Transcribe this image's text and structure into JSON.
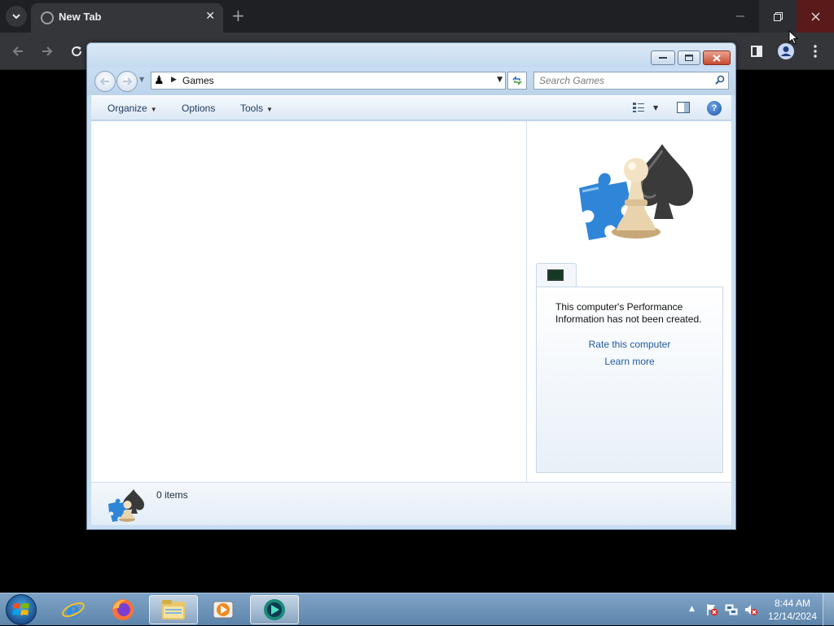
{
  "chrome": {
    "tab_title": "New Tab",
    "icons": {
      "tab_search": "chevron-down-icon",
      "favicon": "globe-icon",
      "tab_close": "close-icon",
      "new_tab": "plus-icon",
      "back": "arrow-left-icon",
      "forward": "arrow-right-icon",
      "reload": "reload-icon",
      "side_panel": "side-panel-icon",
      "profile": "profile-icon",
      "menu": "kebab-menu-icon"
    }
  },
  "window": {
    "address": {
      "location": "Games"
    },
    "search": {
      "placeholder": "Search Games"
    },
    "commands": {
      "organize": "Organize",
      "options": "Options",
      "tools": "Tools"
    },
    "perf": {
      "message": "This computer's Performance Information has not been created.",
      "rate_link": "Rate this computer",
      "learn_link": "Learn more"
    },
    "details": {
      "item_count": "0 items"
    }
  },
  "taskbar": {
    "apps": [
      "Internet Explorer",
      "Firefox",
      "Windows Explorer",
      "Windows Media Player",
      "App"
    ],
    "clock": {
      "time": "8:44 AM",
      "date": "12/14/2024"
    }
  },
  "colors": {
    "chrome_dark": "#35363a",
    "chrome_close_red": "#5a1a1a",
    "explorer_frame": "#c9def2",
    "link_blue": "#1f5a9e",
    "taskbar": "#6d92b8"
  }
}
